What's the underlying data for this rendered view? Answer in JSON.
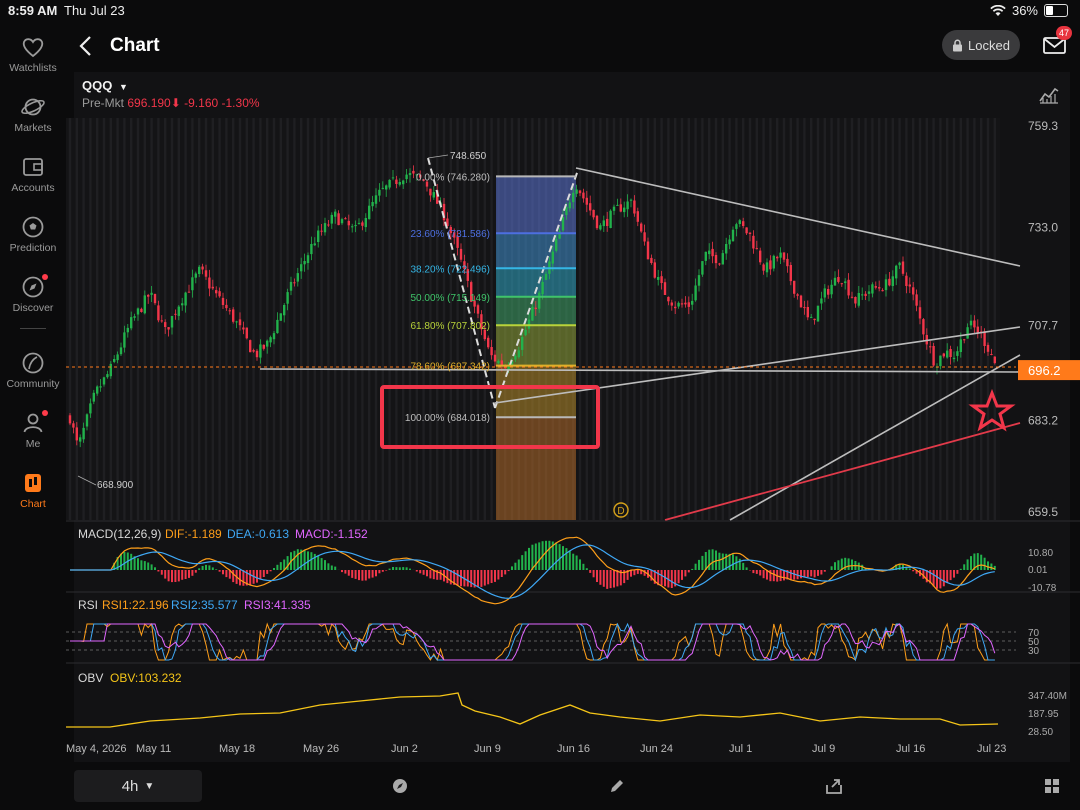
{
  "status_bar": {
    "time": "8:59 AM",
    "date": "Thu Jul 23",
    "battery": "36%"
  },
  "sidebar": {
    "items": [
      {
        "label": "Watchlists",
        "icon": "heart-icon"
      },
      {
        "label": "Markets",
        "icon": "planet-icon"
      },
      {
        "label": "Accounts",
        "icon": "wallet-icon"
      },
      {
        "label": "Prediction",
        "icon": "ball-icon"
      },
      {
        "label": "Discover",
        "icon": "compass-icon"
      },
      {
        "label": "Community",
        "icon": "community-icon"
      },
      {
        "label": "Me",
        "icon": "person-icon"
      },
      {
        "label": "Chart",
        "icon": "candlestick-icon"
      }
    ]
  },
  "header": {
    "title": "Chart",
    "locked_label": "Locked",
    "mail_badge": "47"
  },
  "quote": {
    "symbol": "QQQ",
    "session": "Pre-Mkt",
    "price": "696.190",
    "change": "-9.160",
    "change_pct": "-1.30%"
  },
  "colors": {
    "accent": "#ff7a1a",
    "up": "#22b24c",
    "down": "#f2364a",
    "dif": "#ff9f1a",
    "dea": "#3fa8f5",
    "rsi3": "#e066ff",
    "obv": "#f5c518"
  },
  "price_axis": {
    "ticks": [
      "759.3",
      "733.0",
      "707.7",
      "683.2",
      "659.5"
    ],
    "current": "696.2"
  },
  "fib": {
    "levels": [
      {
        "label": "0.00% (746.280)",
        "price": 746.28
      },
      {
        "label": "23.60% (731.586)",
        "price": 731.586
      },
      {
        "label": "38.20% (722.496)",
        "price": 722.496
      },
      {
        "label": "50.00% (715.149)",
        "price": 715.149
      },
      {
        "label": "61.80% (707.802)",
        "price": 707.802
      },
      {
        "label": "78.60% (697.342)",
        "price": 697.342
      },
      {
        "label": "100.00% (684.018)",
        "price": 684.018
      }
    ]
  },
  "annotations": {
    "high": "748.650",
    "low": "668.900",
    "dividend_marker": "D"
  },
  "macd": {
    "name": "MACD(12,26,9)",
    "dif": "DIF:-1.189",
    "dea": "DEA:-0.613",
    "macd": "MACD:-1.152",
    "axis": [
      "10.80",
      "0.01",
      "-10.78"
    ]
  },
  "rsi": {
    "name": "RSI",
    "rsi1": "RSI1:22.196",
    "rsi2": "RSI2:35.577",
    "rsi3": "RSI3:41.335",
    "axis": [
      "70",
      "50",
      "30"
    ]
  },
  "obv": {
    "name": "OBV",
    "value": "OBV:103.232",
    "axis": [
      "347.40M",
      "187.95",
      "28.50"
    ]
  },
  "date_axis": [
    "May 4, 2026",
    "May 11",
    "May 18",
    "May 26",
    "Jun 2",
    "Jun 9",
    "Jun 16",
    "Jun 24",
    "Jul 1",
    "Jul 9",
    "Jul 16",
    "Jul 23"
  ],
  "toolbar": {
    "interval": "4h"
  }
}
